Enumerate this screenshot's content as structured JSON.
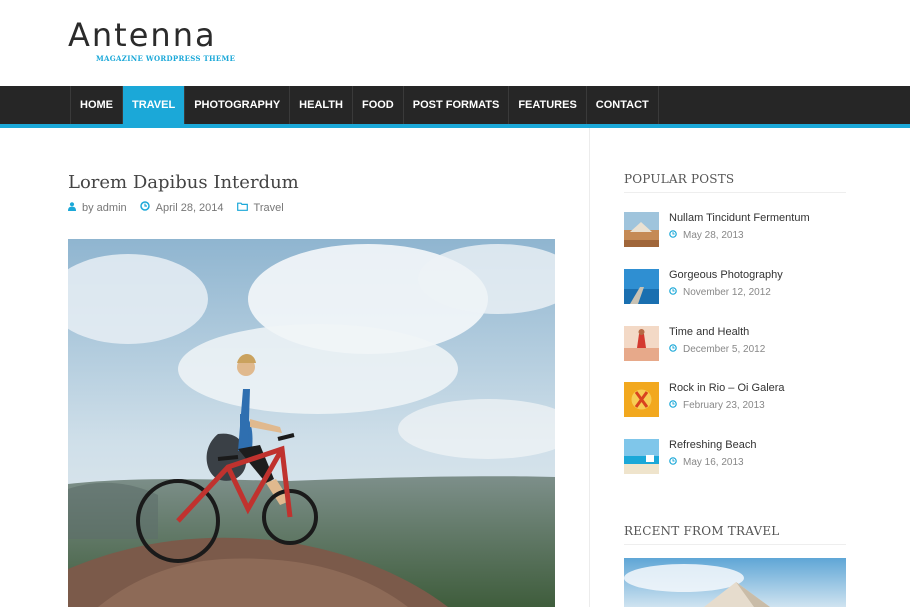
{
  "site": {
    "logo_text": "Antenna",
    "tagline": "MAGAZINE WORDPRESS THEME"
  },
  "nav": {
    "items": [
      "HOME",
      "TRAVEL",
      "PHOTOGRAPHY",
      "HEALTH",
      "FOOD",
      "POST FORMATS",
      "FEATURES",
      "CONTACT"
    ],
    "active": "TRAVEL"
  },
  "post": {
    "title": "Lorem Dapibus Interdum",
    "author": "by admin",
    "date": "April 28, 2014",
    "category": "Travel"
  },
  "sidebar": {
    "popular_title": "POPULAR POSTS",
    "popular": [
      {
        "title": "Nullam Tincidunt Fermentum",
        "date": "May 28, 2013"
      },
      {
        "title": "Gorgeous Photography",
        "date": "November 12, 2012"
      },
      {
        "title": "Time and Health",
        "date": "December 5, 2012"
      },
      {
        "title": "Rock in Rio – Oi Galera",
        "date": "February 23, 2013"
      },
      {
        "title": "Refreshing Beach",
        "date": "May 16, 2013"
      }
    ],
    "recent_title": "RECENT FROM TRAVEL"
  },
  "icons": {
    "author": "user-icon",
    "date": "clock-icon",
    "category": "folder-icon"
  },
  "colors": {
    "accent": "#1ba8d8",
    "navbar": "#262626"
  }
}
